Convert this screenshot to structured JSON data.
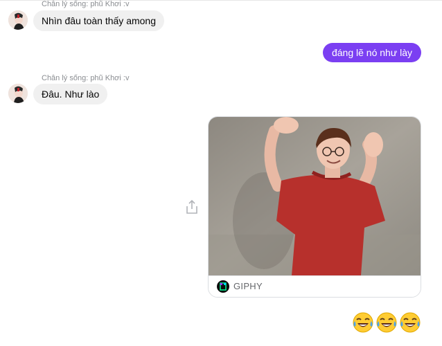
{
  "messages": [
    {
      "sender": "Chân lý sống: phũ Khơi :v",
      "text": "Nhìn đâu toàn thấy among"
    },
    {
      "text": "đáng lẽ nó như lày"
    },
    {
      "sender": "Chân lý sống: phũ Khơi :v",
      "text": "Đâu. Như lào"
    }
  ],
  "gif": {
    "source_label": "GIPHY"
  },
  "reaction_emojis": [
    "face-with-tears-of-joy",
    "face-with-tears-of-joy",
    "face-with-tears-of-joy"
  ],
  "colors": {
    "outgoing_bubble": "#7b3ff2",
    "incoming_bubble": "#f0f0f0"
  }
}
